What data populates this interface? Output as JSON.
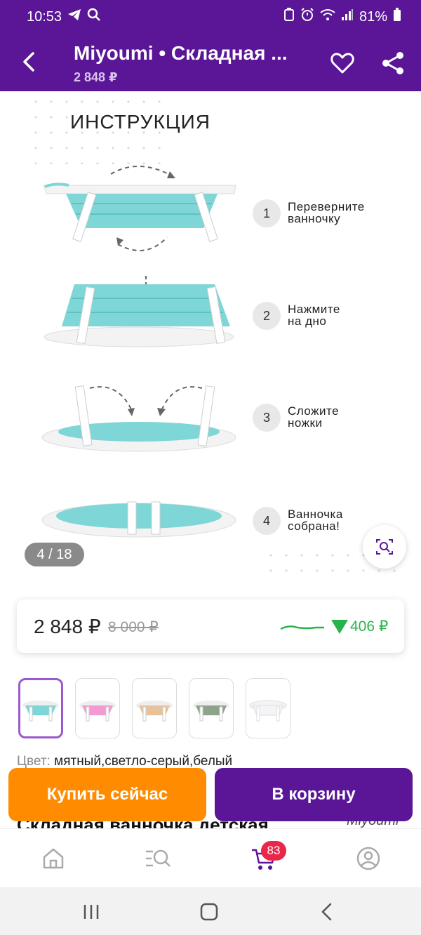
{
  "status": {
    "time": "10:53",
    "battery": "81%"
  },
  "appbar": {
    "title": "Miyoumi • Складная ...",
    "subtitle": "2 848 ₽"
  },
  "gallery": {
    "heading": "ИНСТРУКЦИЯ",
    "steps": [
      {
        "num": "1",
        "text": "Переверните\nванночку"
      },
      {
        "num": "2",
        "text": "Нажмите\nна дно"
      },
      {
        "num": "3",
        "text": "Сложите\nножки"
      },
      {
        "num": "4",
        "text": "Ванночка\nсобрана!"
      }
    ],
    "counter": "4 / 18"
  },
  "price": {
    "current": "2 848 ₽",
    "old": "8 000 ₽",
    "drop": "406 ₽"
  },
  "colors": {
    "accent": "#5a1696",
    "buy": "#ff8c00",
    "drop": "#2ab34a",
    "badge": "#e8274b"
  },
  "color_variants": [
    "mint",
    "pink",
    "beige",
    "gray-green",
    "white"
  ],
  "color_line": {
    "label": "Цвет:",
    "value": "мятный,светло-серый,белый"
  },
  "product": {
    "title": "Складная ванночка детская",
    "brand": "Miyoumi"
  },
  "buttons": {
    "buy_now": "Купить сейчас",
    "add_to_cart": "В корзину"
  },
  "nav": {
    "cart_badge": "83"
  }
}
